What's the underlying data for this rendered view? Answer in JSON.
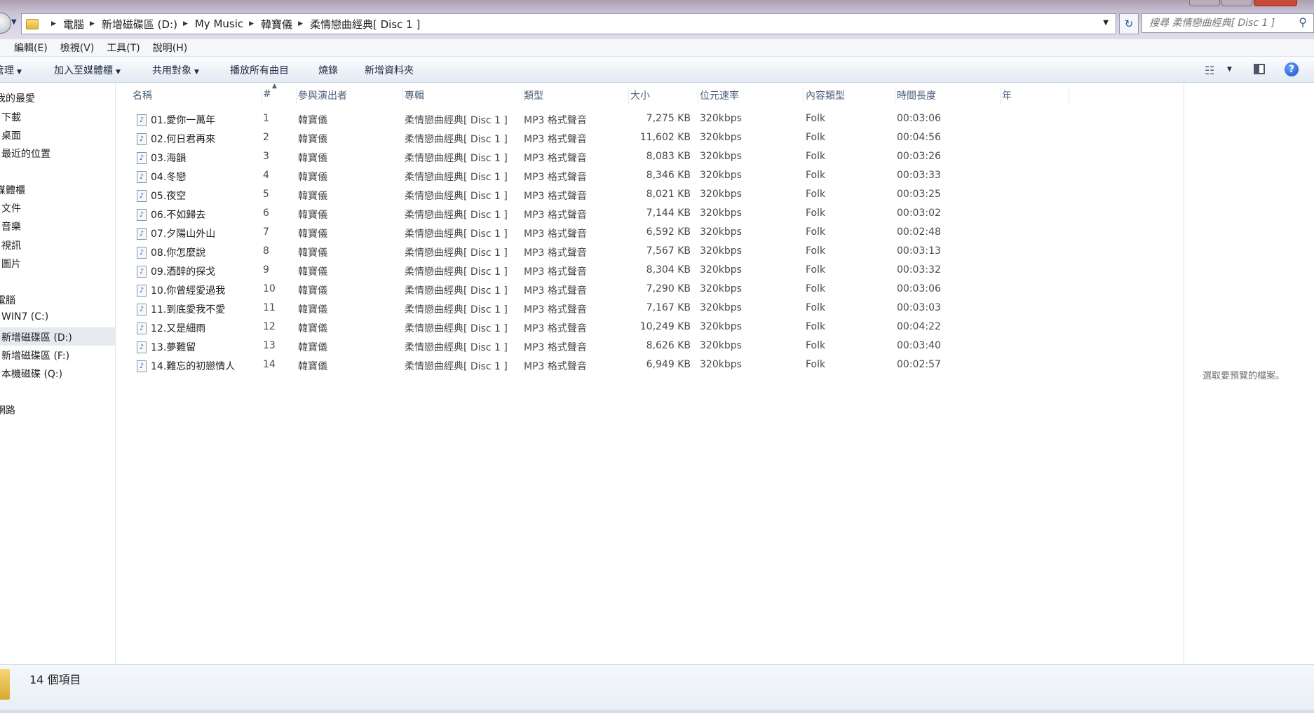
{
  "address": {
    "breadcrumbs": [
      "電腦",
      "新增磁碟區 (D:)",
      "My Music",
      "韓寶儀",
      "柔情戀曲經典[ Disc 1 ]"
    ],
    "search_placeholder": "搜尋 柔情戀曲經典[ Disc 1 ]"
  },
  "menu": [
    "編輯(E)",
    "檢視(V)",
    "工具(T)",
    "說明(H)"
  ],
  "commands": {
    "organize": "管理",
    "add_to_library": "加入至媒體櫃",
    "share_with": "共用對象",
    "play_all": "播放所有曲目",
    "burn": "燒錄",
    "new_folder": "新增資料夾"
  },
  "nav": {
    "favorites": "我的最愛",
    "downloads": "下載",
    "desktop": "桌面",
    "recent": "最近的位置",
    "libraries": "媒體櫃",
    "documents": "文件",
    "music": "音樂",
    "videos": "視訊",
    "pictures": "圖片",
    "computer": "電腦",
    "drive_c": "WIN7 (C:)",
    "drive_d": "新增磁碟區 (D:)",
    "drive_f": "新增磁碟區 (F:)",
    "drive_q": "本機磁碟 (Q:)",
    "network": "網路"
  },
  "columns": [
    "名稱",
    "#",
    "參與演出者",
    "專輯",
    "類型",
    "大小",
    "位元速率",
    "內容類型",
    "時間長度",
    "年"
  ],
  "files": [
    {
      "name": "01.愛你一萬年",
      "num": "1",
      "artist": "韓寶儀",
      "album": "柔情戀曲經典[ Disc 1 ]",
      "type": "MP3 格式聲音",
      "size": "7,275 KB",
      "bitrate": "320kbps",
      "genre": "Folk",
      "length": "00:03:06"
    },
    {
      "name": "02.何日君再來",
      "num": "2",
      "artist": "韓寶儀",
      "album": "柔情戀曲經典[ Disc 1 ]",
      "type": "MP3 格式聲音",
      "size": "11,602 KB",
      "bitrate": "320kbps",
      "genre": "Folk",
      "length": "00:04:56"
    },
    {
      "name": "03.海韻",
      "num": "3",
      "artist": "韓寶儀",
      "album": "柔情戀曲經典[ Disc 1 ]",
      "type": "MP3 格式聲音",
      "size": "8,083 KB",
      "bitrate": "320kbps",
      "genre": "Folk",
      "length": "00:03:26"
    },
    {
      "name": "04.冬戀",
      "num": "4",
      "artist": "韓寶儀",
      "album": "柔情戀曲經典[ Disc 1 ]",
      "type": "MP3 格式聲音",
      "size": "8,346 KB",
      "bitrate": "320kbps",
      "genre": "Folk",
      "length": "00:03:33"
    },
    {
      "name": "05.夜空",
      "num": "5",
      "artist": "韓寶儀",
      "album": "柔情戀曲經典[ Disc 1 ]",
      "type": "MP3 格式聲音",
      "size": "8,021 KB",
      "bitrate": "320kbps",
      "genre": "Folk",
      "length": "00:03:25"
    },
    {
      "name": "06.不如歸去",
      "num": "6",
      "artist": "韓寶儀",
      "album": "柔情戀曲經典[ Disc 1 ]",
      "type": "MP3 格式聲音",
      "size": "7,144 KB",
      "bitrate": "320kbps",
      "genre": "Folk",
      "length": "00:03:02"
    },
    {
      "name": "07.夕陽山外山",
      "num": "7",
      "artist": "韓寶儀",
      "album": "柔情戀曲經典[ Disc 1 ]",
      "type": "MP3 格式聲音",
      "size": "6,592 KB",
      "bitrate": "320kbps",
      "genre": "Folk",
      "length": "00:02:48"
    },
    {
      "name": "08.你怎麼說",
      "num": "8",
      "artist": "韓寶儀",
      "album": "柔情戀曲經典[ Disc 1 ]",
      "type": "MP3 格式聲音",
      "size": "7,567 KB",
      "bitrate": "320kbps",
      "genre": "Folk",
      "length": "00:03:13"
    },
    {
      "name": "09.酒醉的探戈",
      "num": "9",
      "artist": "韓寶儀",
      "album": "柔情戀曲經典[ Disc 1 ]",
      "type": "MP3 格式聲音",
      "size": "8,304 KB",
      "bitrate": "320kbps",
      "genre": "Folk",
      "length": "00:03:32"
    },
    {
      "name": "10.你曾經愛過我",
      "num": "10",
      "artist": "韓寶儀",
      "album": "柔情戀曲經典[ Disc 1 ]",
      "type": "MP3 格式聲音",
      "size": "7,290 KB",
      "bitrate": "320kbps",
      "genre": "Folk",
      "length": "00:03:06"
    },
    {
      "name": "11.到底愛我不愛",
      "num": "11",
      "artist": "韓寶儀",
      "album": "柔情戀曲經典[ Disc 1 ]",
      "type": "MP3 格式聲音",
      "size": "7,167 KB",
      "bitrate": "320kbps",
      "genre": "Folk",
      "length": "00:03:03"
    },
    {
      "name": "12.又是細雨",
      "num": "12",
      "artist": "韓寶儀",
      "album": "柔情戀曲經典[ Disc 1 ]",
      "type": "MP3 格式聲音",
      "size": "10,249 KB",
      "bitrate": "320kbps",
      "genre": "Folk",
      "length": "00:04:22"
    },
    {
      "name": "13.夢難留",
      "num": "13",
      "artist": "韓寶儀",
      "album": "柔情戀曲經典[ Disc 1 ]",
      "type": "MP3 格式聲音",
      "size": "8,626 KB",
      "bitrate": "320kbps",
      "genre": "Folk",
      "length": "00:03:40"
    },
    {
      "name": "14.難忘的初戀情人",
      "num": "14",
      "artist": "韓寶儀",
      "album": "柔情戀曲經典[ Disc 1 ]",
      "type": "MP3 格式聲音",
      "size": "6,949 KB",
      "bitrate": "320kbps",
      "genre": "Folk",
      "length": "00:02:57"
    }
  ],
  "preview_text": "選取要預覽的檔案。",
  "status": {
    "item_count": "14 個項目"
  },
  "icons": {
    "back": "back-arrow-icon",
    "folder": "folder-icon",
    "refresh": "refresh-icon",
    "search": "search-icon",
    "file": "audio-file-icon",
    "help": "help-icon"
  },
  "colors": {
    "selection": "#e6eaf0",
    "header_text": "#4c607a",
    "title_gradient": "#c7bdd0"
  }
}
